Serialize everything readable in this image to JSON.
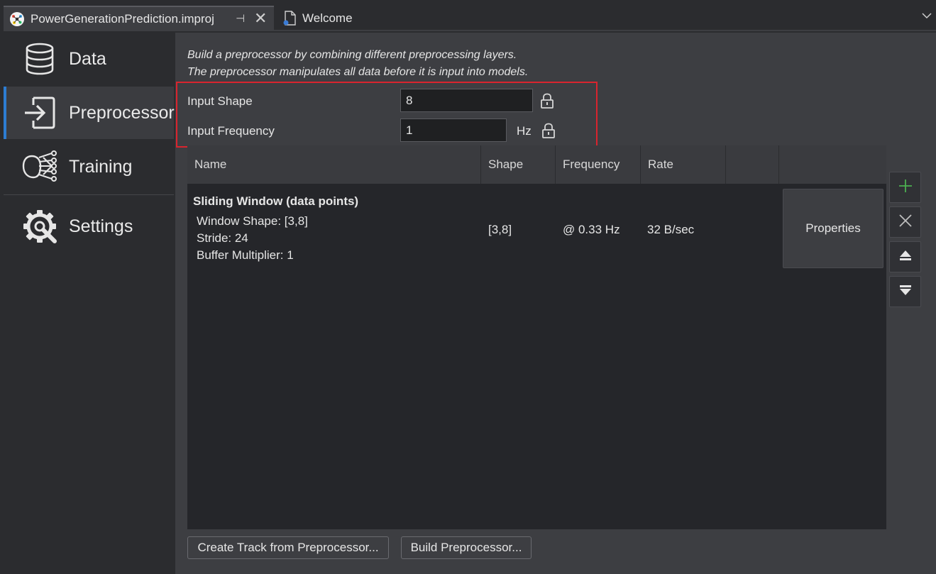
{
  "tabs": [
    {
      "label": "PowerGenerationPrediction.improj",
      "icon": "project-icon",
      "active": true
    },
    {
      "label": "Welcome",
      "icon": "document-icon",
      "active": false
    }
  ],
  "sidebar": {
    "items": [
      {
        "label": "Data",
        "icon": "database-icon",
        "selected": false
      },
      {
        "label": "Preprocessor",
        "icon": "login-arrow-icon",
        "selected": true
      },
      {
        "label": "Training",
        "icon": "network-icon",
        "selected": false
      },
      {
        "label": "Settings",
        "icon": "gear-wrench-icon",
        "selected": false
      }
    ]
  },
  "main": {
    "description_line1": "Build a preprocessor by combining different preprocessing layers.",
    "description_line2": "The preprocessor manipulates all data before it is input into models.",
    "input_shape": {
      "label": "Input Shape",
      "value": "8"
    },
    "input_frequency": {
      "label": "Input Frequency",
      "value": "1",
      "unit": "Hz"
    },
    "table": {
      "columns": [
        "Name",
        "Shape",
        "Frequency",
        "Rate"
      ],
      "rows": [
        {
          "title": "Sliding Window (data points)",
          "details": [
            "Window Shape: [3,8]",
            "Stride: 24",
            "Buffer Multiplier: 1"
          ],
          "shape": "[3,8]",
          "frequency": "@ 0.33 Hz",
          "rate": "32 B/sec",
          "action": "Properties"
        }
      ]
    },
    "toolbar": {
      "add_icon": "plus-icon",
      "remove_icon": "x-icon",
      "move_up_icon": "eject-up-icon",
      "move_down_icon": "eject-down-icon"
    },
    "buttons": {
      "create_track": "Create Track from Preprocessor...",
      "build": "Build Preprocessor..."
    }
  },
  "colors": {
    "accent": "#2d7dd2",
    "highlight": "#d9242e",
    "add_green": "#4caf50"
  }
}
